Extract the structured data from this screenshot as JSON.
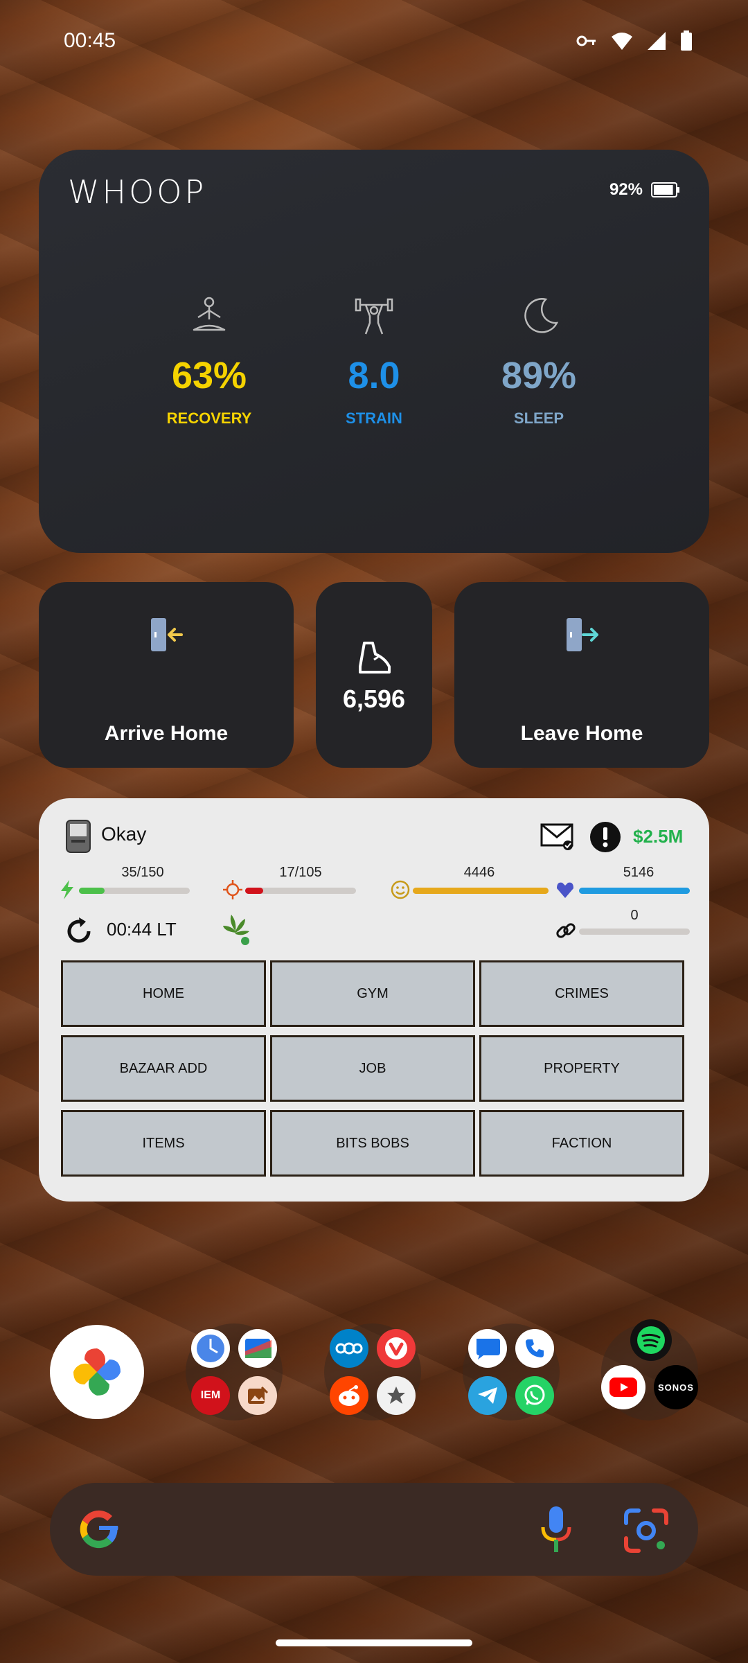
{
  "status": {
    "time": "00:45"
  },
  "whoop": {
    "logo": "WHOOP",
    "battery": "92%",
    "battery_level": 0.92,
    "metrics": [
      {
        "value": "63%",
        "label": "RECOVERY",
        "color": "#f5d300",
        "icon": "meditation-icon"
      },
      {
        "value": "8.0",
        "label": "STRAIN",
        "color": "#1e90e8",
        "icon": "weightlifter-icon"
      },
      {
        "value": "89%",
        "label": "SLEEP",
        "color": "#7fa6c9",
        "icon": "moon-icon"
      }
    ]
  },
  "tiles": {
    "arrive": {
      "label": "Arrive Home",
      "icon": "enter-door-icon"
    },
    "steps": {
      "value": "6,596",
      "icon": "shoe-icon"
    },
    "leave": {
      "label": "Leave Home",
      "icon": "exit-door-icon"
    }
  },
  "torn": {
    "status": "Okay",
    "money": "$2.5M",
    "money_color": "#22b14c",
    "bars": [
      {
        "text": "35/150",
        "fill": 0.233,
        "color": "#4cc04a",
        "icon": "energy-icon"
      },
      {
        "text": "17/105",
        "fill": 0.162,
        "color": "#d1121b",
        "icon": "nerve-icon"
      },
      {
        "text": "4446",
        "fill": 1.0,
        "color": "#e6a81b",
        "icon": "happy-icon"
      },
      {
        "text": "5146",
        "fill": 1.0,
        "color": "#1f9be0",
        "icon": "life-icon"
      }
    ],
    "time": "00:44 LT",
    "chain": {
      "text": "0",
      "fill": 0.0
    },
    "buttons": [
      "HOME",
      "GYM",
      "CRIMES",
      "BAZAAR ADD",
      "JOB",
      "PROPERTY",
      "ITEMS",
      "BITS BOBS",
      "FACTION"
    ]
  },
  "dock": {
    "folder_labels": [
      "IEM",
      "SONOS"
    ]
  }
}
